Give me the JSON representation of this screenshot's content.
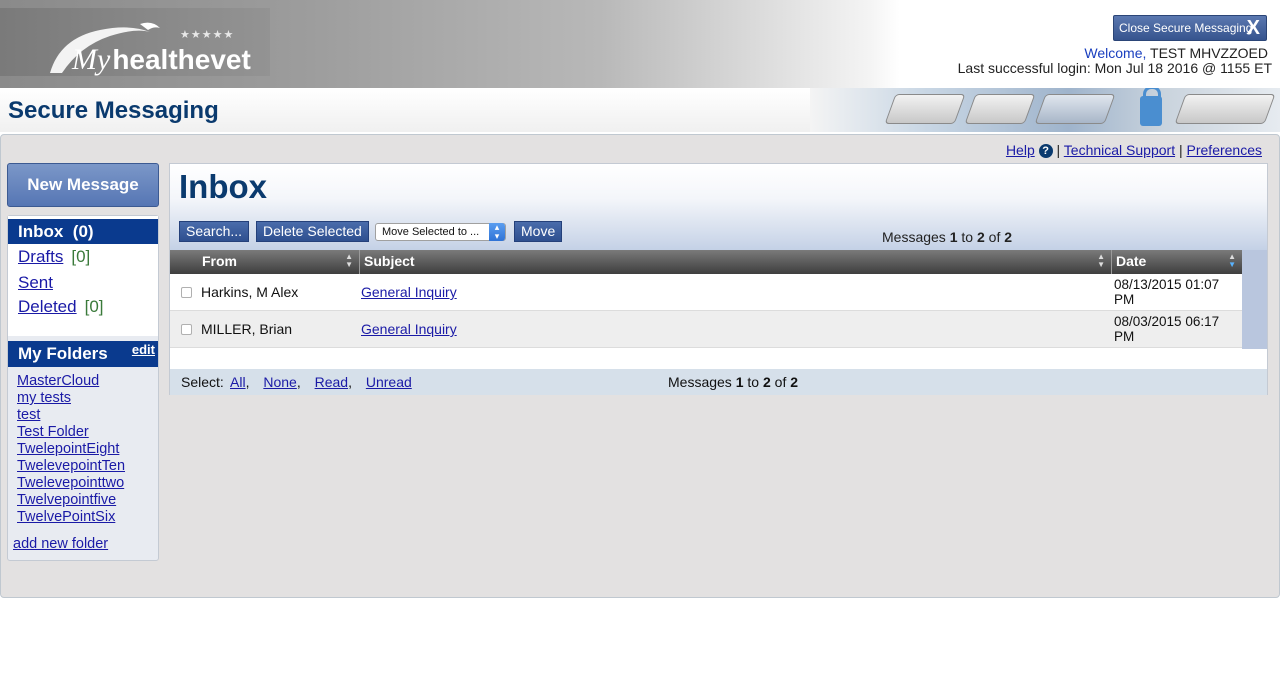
{
  "banner": {
    "logo_my": "My",
    "logo_text": "healthevet",
    "logo_stars": "★★★★★",
    "close_button": "Close Secure Messaging",
    "close_x": "X",
    "welcome_label": "Welcome,",
    "user_name": "TEST MHVZZOED",
    "last_login": "Last successful login: Mon Jul 18 2016 @ 1155 ET"
  },
  "header": {
    "title": "Secure Messaging"
  },
  "toplinks": {
    "help": "Help",
    "help_icon": "?",
    "sep1": "|",
    "tech_support": "Technical Support",
    "sep2": "|",
    "preferences": "Preferences"
  },
  "sidebar": {
    "new_message": "New Message",
    "inbox": "Inbox",
    "inbox_count": "(0)",
    "drafts": "Drafts",
    "drafts_count": "[0]",
    "sent": "Sent",
    "deleted": "Deleted",
    "deleted_count": "[0]",
    "my_folders": "My Folders",
    "edit": "edit",
    "folders": [
      "MasterCloud",
      "my tests",
      "test",
      "Test Folder",
      "TwelepointEight",
      "TwelevepointTen",
      "Twelevepointtwo",
      "Twelvepointfive",
      "TwelvePointSix"
    ],
    "add_folder": "add new folder"
  },
  "inbox": {
    "title": "Inbox",
    "search_button": "Search...",
    "delete_button": "Delete Selected",
    "move_select_value": "Move Selected to ...",
    "move_button": "Move",
    "count_prefix": "Messages",
    "count_from": "1",
    "count_to_word": "to",
    "count_to": "2",
    "count_of_word": "of",
    "count_total": "2",
    "columns": {
      "from": "From",
      "subject": "Subject",
      "date": "Date"
    },
    "rows": [
      {
        "from": "Harkins, M Alex",
        "subject": "General Inquiry",
        "date": "08/13/2015 01:07 PM"
      },
      {
        "from": "MILLER, Brian",
        "subject": "General Inquiry",
        "date": "08/03/2015 06:17 PM"
      }
    ],
    "select_label": "Select:",
    "select_all": "All",
    "select_none": "None",
    "select_read": "Read",
    "select_unread": "Unread",
    "comma": ","
  },
  "colors": {
    "accent_navy": "#0a3a8e",
    "title_blue": "#0a3a6e",
    "link_blue": "#1a1aa6"
  }
}
